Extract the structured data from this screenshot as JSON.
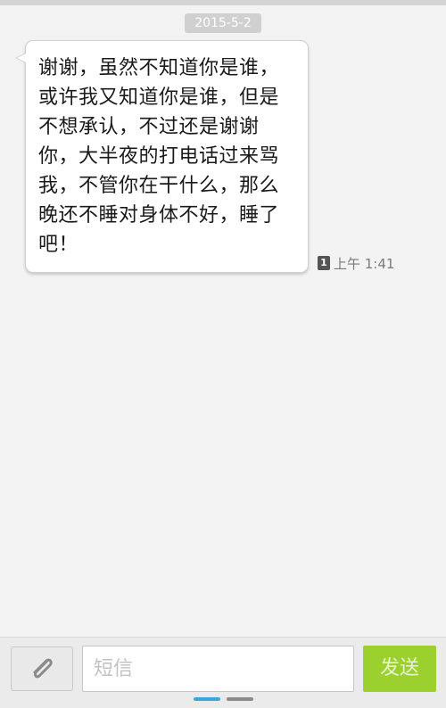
{
  "conversation": {
    "date_separator": "2015-5-2",
    "messages": [
      {
        "text": "谢谢，虽然不知道你是谁，或许我又知道你是谁，但是不想承认，不过还是谢谢你，大半夜的打电话过来骂我，不管你在干什么，那么晚还不睡对身体不好，睡了吧！",
        "sim_slot": "1",
        "time": "上午 1:41"
      }
    ]
  },
  "composer": {
    "placeholder": "短信",
    "value": "",
    "send_label": "发送",
    "attach_icon": "paperclip-icon"
  },
  "colors": {
    "background": "#f3f3f3",
    "bubble": "#ffffff",
    "send_button": "#9bd02f",
    "active_page_dot": "#3aa6dc"
  }
}
